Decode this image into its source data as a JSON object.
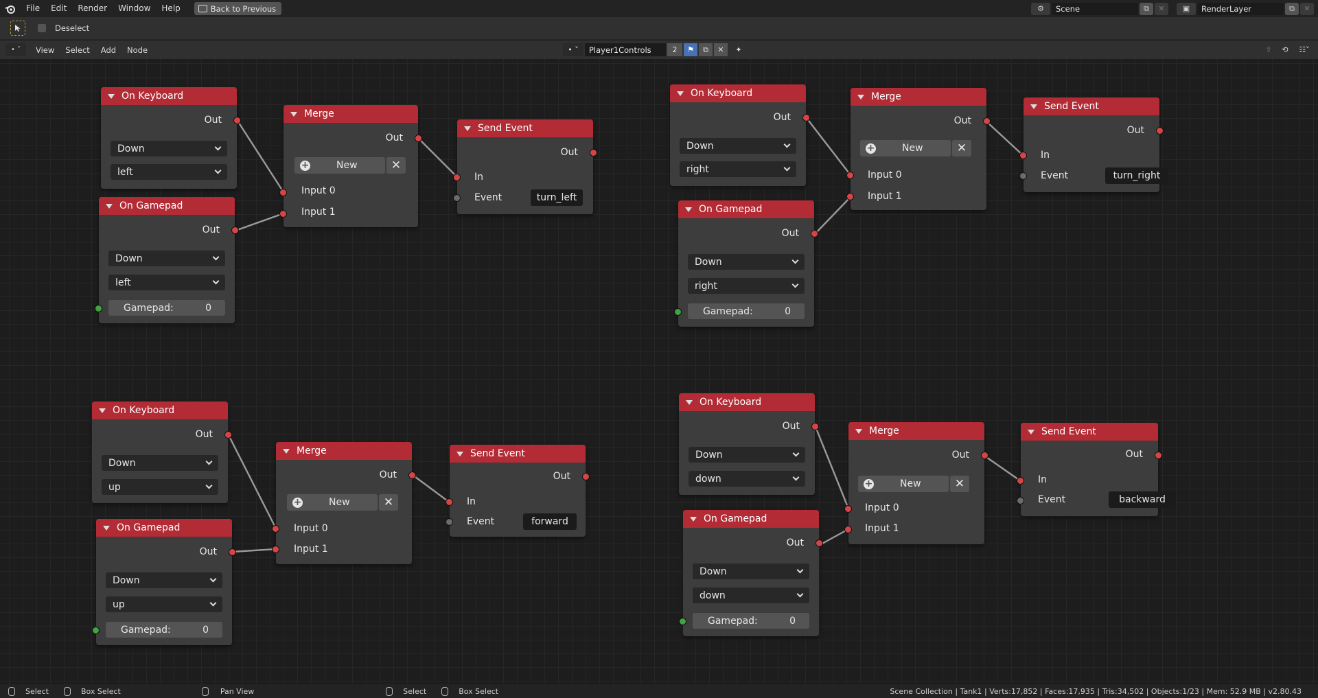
{
  "menu": {
    "items": [
      "File",
      "Edit",
      "Render",
      "Window",
      "Help"
    ],
    "back_label": "Back to Previous",
    "scene": "Scene",
    "render_layer": "RenderLayer"
  },
  "tool_header": {
    "deselect_label": "Deselect"
  },
  "editor_header": {
    "menus": [
      "View",
      "Select",
      "Add",
      "Node"
    ],
    "tree_name": "Player1Controls",
    "users_count": "2"
  },
  "groups": [
    {
      "keyboard": {
        "title": "On Keyboard",
        "out": "Out",
        "state": "Down",
        "key": "left"
      },
      "gamepad": {
        "title": "On Gamepad",
        "out": "Out",
        "state": "Down",
        "key": "left",
        "label": "Gamepad:",
        "value": "0"
      },
      "merge": {
        "title": "Merge",
        "out": "Out",
        "new_label": "New",
        "input0": "Input 0",
        "input1": "Input 1"
      },
      "send": {
        "title": "Send Event",
        "out": "Out",
        "in": "In",
        "event_label": "Event",
        "event_value": "turn_left"
      }
    },
    {
      "keyboard": {
        "title": "On Keyboard",
        "out": "Out",
        "state": "Down",
        "key": "right"
      },
      "gamepad": {
        "title": "On Gamepad",
        "out": "Out",
        "state": "Down",
        "key": "right",
        "label": "Gamepad:",
        "value": "0"
      },
      "merge": {
        "title": "Merge",
        "out": "Out",
        "new_label": "New",
        "input0": "Input 0",
        "input1": "Input 1"
      },
      "send": {
        "title": "Send Event",
        "out": "Out",
        "in": "In",
        "event_label": "Event",
        "event_value": "turn_right"
      }
    },
    {
      "keyboard": {
        "title": "On Keyboard",
        "out": "Out",
        "state": "Down",
        "key": "up"
      },
      "gamepad": {
        "title": "On Gamepad",
        "out": "Out",
        "state": "Down",
        "key": "up",
        "label": "Gamepad:",
        "value": "0"
      },
      "merge": {
        "title": "Merge",
        "out": "Out",
        "new_label": "New",
        "input0": "Input 0",
        "input1": "Input 1"
      },
      "send": {
        "title": "Send Event",
        "out": "Out",
        "in": "In",
        "event_label": "Event",
        "event_value": "forward"
      }
    },
    {
      "keyboard": {
        "title": "On Keyboard",
        "out": "Out",
        "state": "Down",
        "key": "down"
      },
      "gamepad": {
        "title": "On Gamepad",
        "out": "Out",
        "state": "Down",
        "key": "down",
        "label": "Gamepad:",
        "value": "0"
      },
      "merge": {
        "title": "Merge",
        "out": "Out",
        "new_label": "New",
        "input0": "Input 0",
        "input1": "Input 1"
      },
      "send": {
        "title": "Send Event",
        "out": "Out",
        "in": "In",
        "event_label": "Event",
        "event_value": "backward"
      }
    }
  ],
  "status": {
    "select1": "Select",
    "box_select1": "Box Select",
    "pan_view": "Pan View",
    "select2": "Select",
    "box_select2": "Box Select",
    "stats": "Scene Collection | Tank1 | Verts:17,852 | Faces:17,935 | Tris:34,502 | Objects:1/23 | Mem: 52.9 MB | v2.80.43"
  },
  "colors": {
    "node_header": "#b22b35",
    "node_body": "#3d3d3d",
    "socket_event": "#d64545",
    "socket_gamepad": "#3fa63f",
    "socket_string": "#6b6b6b"
  }
}
